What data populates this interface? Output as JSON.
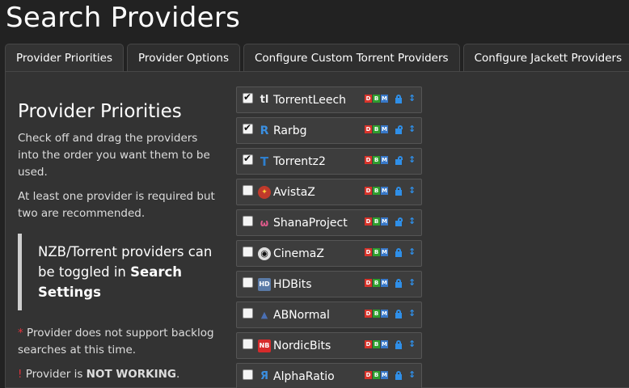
{
  "page_title": "Search Providers",
  "tabs": [
    {
      "label": "Provider Priorities",
      "active": true
    },
    {
      "label": "Provider Options",
      "active": false
    },
    {
      "label": "Configure Custom Torrent Providers",
      "active": false
    },
    {
      "label": "Configure Jackett Providers",
      "active": false
    }
  ],
  "left": {
    "heading": "Provider Priorities",
    "para1": "Check off and drag the providers into the order you want them to be used.",
    "para2": "At least one provider is required but two are recommended.",
    "note_prefix": "NZB/Torrent providers can be toggled in ",
    "note_bold": "Search Settings",
    "legend_star_symbol": "*",
    "legend_star_text": " Provider does not support backlog searches at this time.",
    "legend_bang_symbol": "!",
    "legend_bang_prefix": " Provider is ",
    "legend_bang_bold": "NOT WORKING",
    "legend_bang_suffix": "."
  },
  "badge_letters": {
    "d": "D",
    "b": "B",
    "m": "M"
  },
  "colors": {
    "accent": "#2f8fe8",
    "danger": "#e0323c",
    "badge_d": "#d9342b",
    "badge_b": "#2f9e2f",
    "badge_m": "#3878c8"
  },
  "providers": [
    {
      "name": "TorrentLeech",
      "checked": true,
      "icon": "torrentleech-icon",
      "glyph": "tl",
      "lock": "closed"
    },
    {
      "name": "Rarbg",
      "checked": true,
      "icon": "rarbg-icon",
      "glyph": "R",
      "lock": "open"
    },
    {
      "name": "Torrentz2",
      "checked": true,
      "icon": "torrentz2-icon",
      "glyph": "T",
      "lock": "open"
    },
    {
      "name": "AvistaZ",
      "checked": false,
      "icon": "avistaz-icon",
      "glyph": "✦",
      "lock": "closed"
    },
    {
      "name": "ShanaProject",
      "checked": false,
      "icon": "shanaproject-icon",
      "glyph": "ω",
      "lock": "open"
    },
    {
      "name": "CinemaZ",
      "checked": false,
      "icon": "cinemaz-icon",
      "glyph": "◉",
      "lock": "closed"
    },
    {
      "name": "HDBits",
      "checked": false,
      "icon": "hdbits-icon",
      "glyph": "HD",
      "lock": "closed"
    },
    {
      "name": "ABNormal",
      "checked": false,
      "icon": "abnormal-icon",
      "glyph": "▲",
      "lock": "closed"
    },
    {
      "name": "NordicBits",
      "checked": false,
      "icon": "nordicbits-icon",
      "glyph": "NB",
      "lock": "closed"
    },
    {
      "name": "AlphaRatio",
      "checked": false,
      "icon": "alpharatio-icon",
      "glyph": "Я",
      "lock": "closed"
    }
  ]
}
